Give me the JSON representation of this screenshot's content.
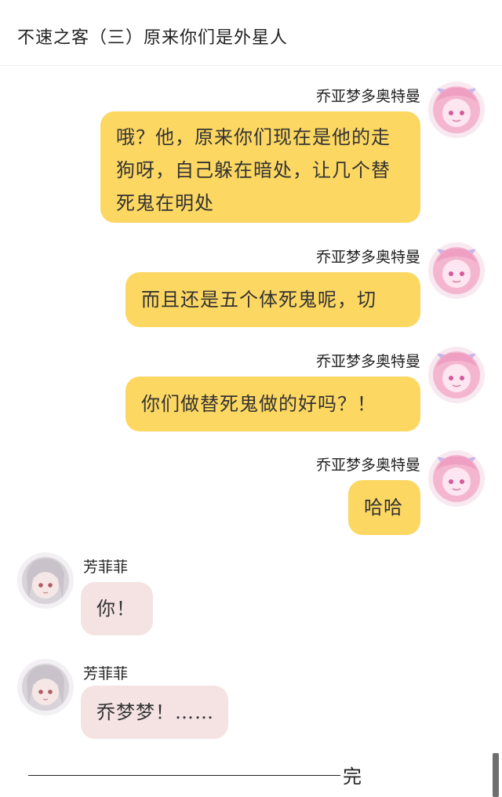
{
  "header": {
    "title": "不速之客（三）原来你们是外星人"
  },
  "messages": [
    {
      "sender": "乔亚梦多奥特曼",
      "text": "哦？他，原来你们现在是他的走狗呀，自己躲在暗处，让几个替死鬼在明处",
      "side": "right"
    },
    {
      "sender": "乔亚梦多奥特曼",
      "text": "而且还是五个体死鬼呢，切",
      "side": "right"
    },
    {
      "sender": "乔亚梦多奥特曼",
      "text": "你们做替死鬼做的好吗？！",
      "side": "right"
    },
    {
      "sender": "乔亚梦多奥特曼",
      "text": "哈哈",
      "side": "right"
    },
    {
      "sender": "芳菲菲",
      "text": "你！",
      "side": "left"
    },
    {
      "sender": "芳菲菲",
      "text": "乔梦梦！……",
      "side": "left"
    }
  ],
  "footer": {
    "end_text": "完"
  },
  "colors": {
    "right_bubble": "#fcd762",
    "left_bubble": "#f5e3e4",
    "pink_avatar": "#f4b6cf",
    "grey_avatar": "#d7d3d8"
  },
  "icons": {
    "right_avatar": "pink-anime-girl-avatar-icon",
    "left_avatar": "grey-haired-anime-girl-avatar-icon"
  }
}
